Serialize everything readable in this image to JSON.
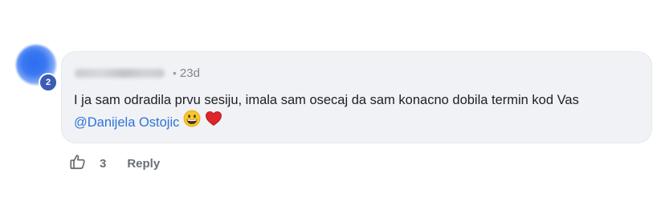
{
  "comment": {
    "author_badge_count": "2",
    "author_name": "",
    "separator": "•",
    "timestamp": "23d",
    "text": "I ja sam odradila prvu sesiju, imala sam osecaj da sam konacno dobila termin kod Vas",
    "mention": "@Danijela Ostojic",
    "emojis": [
      "grinning-face",
      "red-heart"
    ]
  },
  "actions": {
    "like_count": "3",
    "reply_label": "Reply"
  },
  "colors": {
    "avatar": "#2d6df0",
    "badge": "#3c5bb5",
    "bubble_bg": "#f0f2f5",
    "mention": "#2f73d8",
    "heart": "#e0242a",
    "emoji_face": "#f9c62b"
  }
}
